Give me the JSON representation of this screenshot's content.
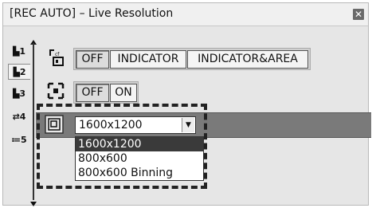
{
  "window": {
    "title": "[REC AUTO] – Live Resolution",
    "close_glyph": "✕"
  },
  "left_tabs": [
    {
      "label": "▙1",
      "icon": "camera-1-icon"
    },
    {
      "label": "▙2",
      "icon": "camera-2-icon"
    },
    {
      "label": "▙3",
      "icon": "camera-3-icon"
    },
    {
      "label": "⇄4",
      "icon": "swap-4-icon"
    },
    {
      "label": "≔5",
      "icon": "settings-5-icon"
    }
  ],
  "rows": {
    "indicator": {
      "icon": "focus-indicator-icon",
      "options": [
        "OFF",
        "INDICATOR",
        "INDICATOR&AREA"
      ],
      "selected": "OFF"
    },
    "area_frame": {
      "icon": "area-frame-icon",
      "options": [
        "OFF",
        "ON"
      ],
      "selected": "OFF"
    },
    "resolution": {
      "icon": "live-resolution-icon",
      "value": "1600x1200",
      "options": [
        "1600x1200",
        "800x600",
        "800x600 Binning"
      ]
    }
  },
  "colors": {
    "panel_bg": "#e6e6e6",
    "band": "#7a7a7a",
    "selected_item": "#3a3a3a"
  }
}
